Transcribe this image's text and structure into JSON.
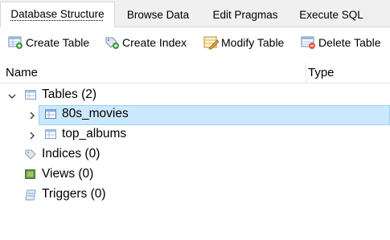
{
  "tabs": [
    {
      "label": "Database Structure",
      "active": true
    },
    {
      "label": "Browse Data",
      "active": false
    },
    {
      "label": "Edit Pragmas",
      "active": false
    },
    {
      "label": "Execute SQL",
      "active": false
    }
  ],
  "toolbar": {
    "create_table": {
      "label": "Create Table",
      "icon": "create-table-icon"
    },
    "create_index": {
      "label": "Create Index",
      "icon": "create-index-icon"
    },
    "modify_table": {
      "label": "Modify Table",
      "icon": "modify-table-icon"
    },
    "delete_table": {
      "label": "Delete Table",
      "icon": "delete-table-icon"
    }
  },
  "columns": {
    "name": "Name",
    "type": "Type"
  },
  "tree": {
    "tables": {
      "label": "Tables (2)",
      "expanded": true
    },
    "table_items": [
      {
        "label": "80s_movies",
        "selected": true
      },
      {
        "label": "top_albums",
        "selected": false
      }
    ],
    "indices": {
      "label": "Indices (0)"
    },
    "views": {
      "label": "Views (0)"
    },
    "triggers": {
      "label": "Triggers (0)"
    }
  },
  "colors": {
    "selection_bg": "#cce8ff",
    "selection_border": "#99d1ff",
    "tab_strip_bg": "#f0f0f0"
  }
}
